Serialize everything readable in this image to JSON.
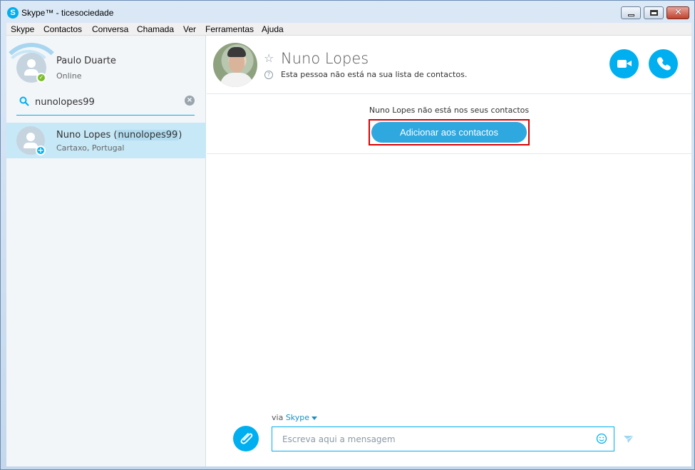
{
  "window": {
    "title": "Skype™ - ticesociedade"
  },
  "menubar": {
    "items": [
      "Skype",
      "Contactos",
      "Conversa",
      "Chamada",
      "Ver",
      "Ferramentas",
      "Ajuda"
    ]
  },
  "profile": {
    "name": "Paulo Duarte",
    "status": "Online"
  },
  "search": {
    "query": "nunolopes99"
  },
  "result": {
    "name": "Nuno Lopes (",
    "handle": "nunolopes99",
    "name_end": ")",
    "location": "Cartaxo, Portugal"
  },
  "contact": {
    "name": "Nuno Lopes",
    "subtitle": "Esta pessoa não está na sua lista de contactos.",
    "notice": "Nuno Lopes não está nos seus contactos",
    "add_label": "Adicionar aos contactos"
  },
  "composer": {
    "via_label": "via",
    "via_service": "Skype",
    "placeholder": "Escreva aqui a mensagem"
  },
  "colors": {
    "accent": "#00aff0",
    "highlight": "#d90000",
    "online": "#7bbf2b"
  },
  "icons": [
    "skype-logo-icon",
    "search-icon",
    "clear-icon",
    "star-icon",
    "help-icon",
    "video-call-icon",
    "audio-call-icon",
    "paperclip-icon",
    "emoji-icon",
    "send-icon"
  ]
}
